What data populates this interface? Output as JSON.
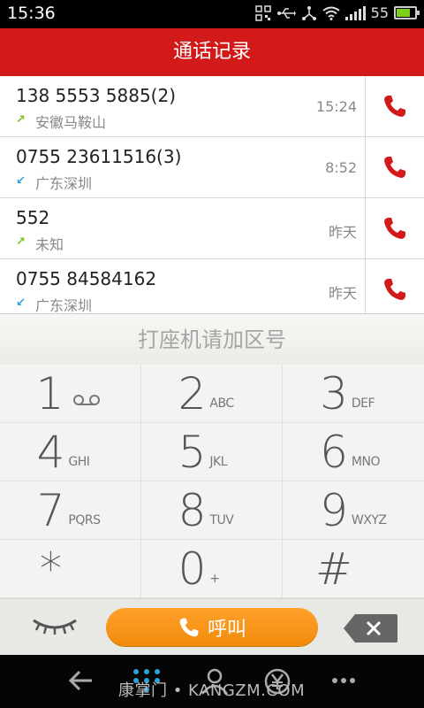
{
  "status_bar": {
    "time": "15:36",
    "battery_level": "55",
    "icons": [
      "qr-icon",
      "usb-icon",
      "share-icon",
      "wifi-icon",
      "signal-icon",
      "battery-icon"
    ]
  },
  "title": "通话记录",
  "calls": [
    {
      "number": "138 5553 5885(2)",
      "location": "安徽马鞍山",
      "time": "15:24",
      "direction": "outgoing",
      "arrow": "↗"
    },
    {
      "number": "0755 23611516(3)",
      "location": "广东深圳",
      "time": "8:52",
      "direction": "incoming",
      "arrow": "↙"
    },
    {
      "number": "552",
      "location": "未知",
      "time": "昨天",
      "direction": "outgoing",
      "arrow": "↗"
    },
    {
      "number": "0755 84584162",
      "location": "广东深圳",
      "time": "昨天",
      "direction": "incoming",
      "arrow": "↙"
    }
  ],
  "dial_hint": "打座机请加区号",
  "keypad": [
    {
      "digit": "1",
      "letters": ""
    },
    {
      "digit": "2",
      "letters": "ABC"
    },
    {
      "digit": "3",
      "letters": "DEF"
    },
    {
      "digit": "4",
      "letters": "GHI"
    },
    {
      "digit": "5",
      "letters": "JKL"
    },
    {
      "digit": "6",
      "letters": "MNO"
    },
    {
      "digit": "7",
      "letters": "PQRS"
    },
    {
      "digit": "8",
      "letters": "TUV"
    },
    {
      "digit": "9",
      "letters": "WXYZ"
    },
    {
      "digit": "*",
      "letters": ""
    },
    {
      "digit": "0",
      "letters": "+"
    },
    {
      "digit": "#",
      "letters": ""
    }
  ],
  "dial_button_label": "呼叫",
  "watermark": "康掌门 • KANGZM.COM",
  "colors": {
    "title_bar": "#d31a1a",
    "call_icon": "#d31a1a",
    "dial_button": "#f5920f",
    "outgoing_arrow": "#7ac21e",
    "incoming_arrow": "#2aa3d8"
  }
}
